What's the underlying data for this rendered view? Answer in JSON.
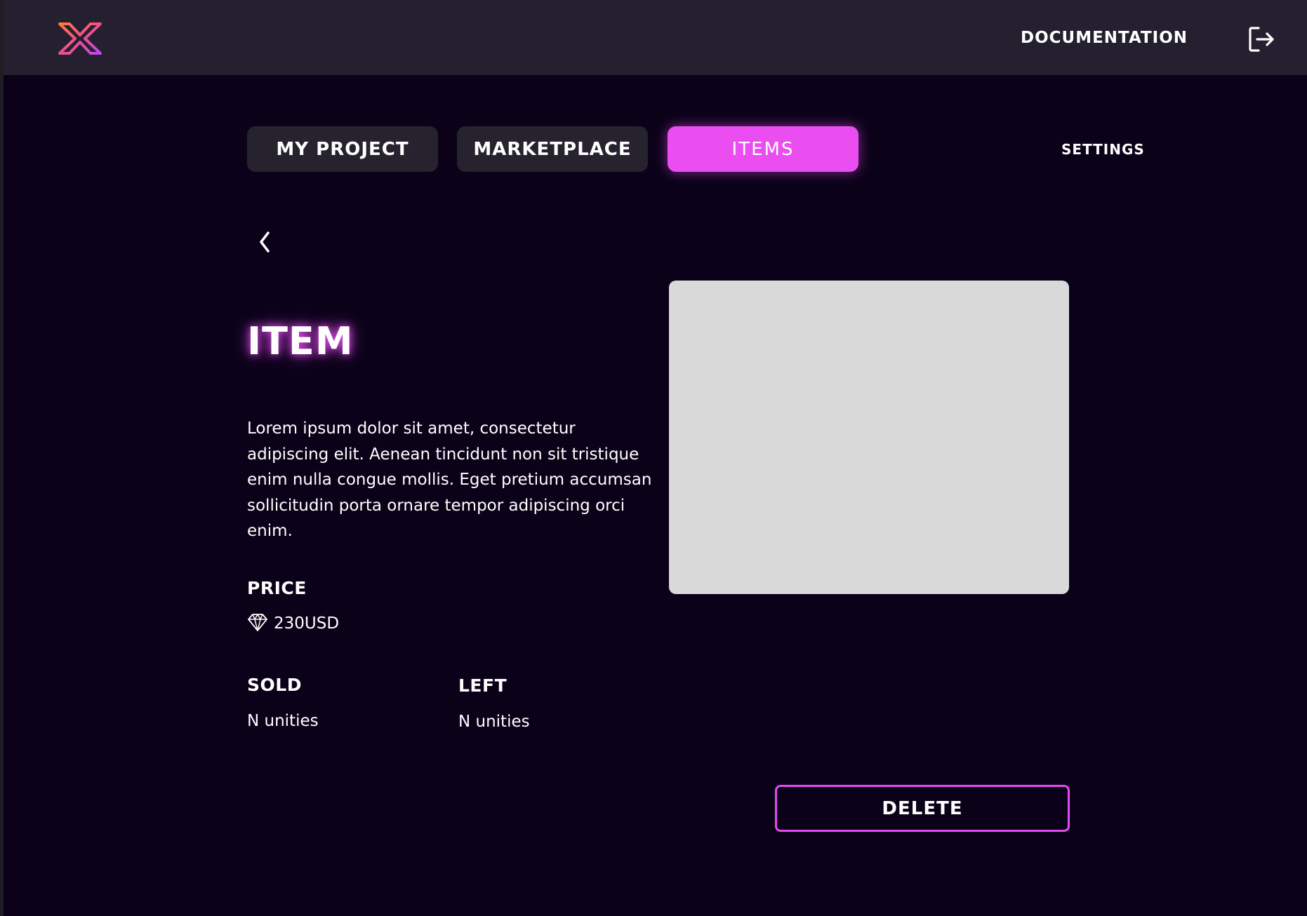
{
  "header": {
    "logo_icon": "x-logo-icon",
    "documentation_label": "DOCUMENTATION",
    "logout_icon": "logout-icon"
  },
  "nav": {
    "tabs": [
      {
        "label": "MY PROJECT",
        "active": false
      },
      {
        "label": "MARKETPLACE",
        "active": false
      },
      {
        "label": "ITEMS",
        "active": true
      }
    ],
    "settings_label": "SETTINGS"
  },
  "item": {
    "back_icon": "chevron-left-icon",
    "title": "ITEM",
    "description": "Lorem ipsum dolor sit amet, consectetur adipiscing elit. Aenean tincidunt non sit tristique enim nulla congue mollis. Eget pretium accumsan sollicitudin porta ornare tempor adipiscing orci enim.",
    "price_label": "PRICE",
    "price_icon": "diamond-icon",
    "price_value": "230USD",
    "sold_label": "SOLD",
    "sold_value": "N unities",
    "left_label": "LEFT",
    "left_value": "N unities",
    "delete_label": "DELETE"
  },
  "colors": {
    "background": "#0b0219",
    "topbar": "#25202f",
    "accent": "#ea4ef0",
    "tab_inactive": "#26222e",
    "image_placeholder": "#d9d9d9"
  }
}
